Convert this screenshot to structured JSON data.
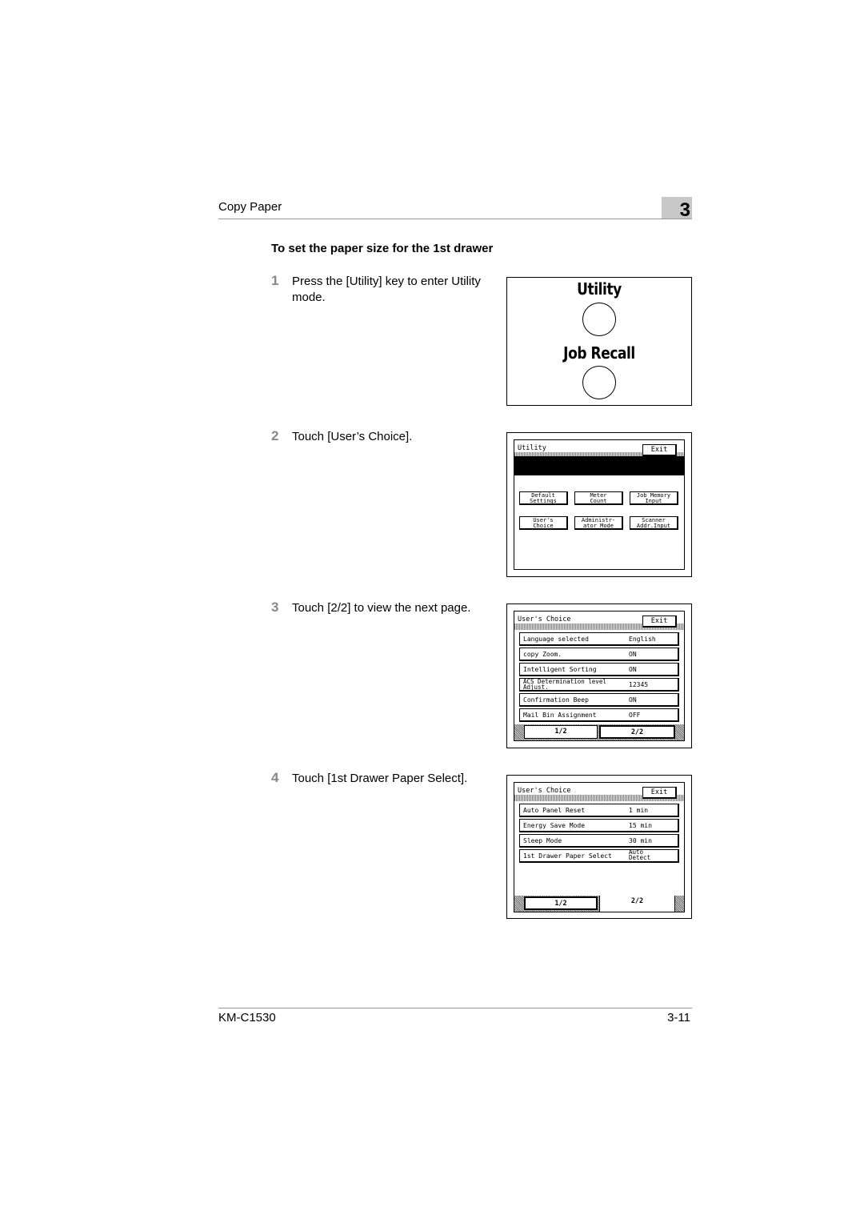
{
  "header": {
    "section": "Copy Paper",
    "chapter": "3"
  },
  "heading": "To set the paper size for the 1st drawer",
  "steps": [
    {
      "number": "1",
      "text": "Press the [Utility] key to enter Utility mode."
    },
    {
      "number": "2",
      "text": "Touch [User’s Choice]."
    },
    {
      "number": "3",
      "text": "Touch [2/2] to view the next page."
    },
    {
      "number": "4",
      "text": "Touch [1st Drawer Paper Select]."
    }
  ],
  "keys": {
    "utility": "Utility",
    "job_recall": "Job Recall"
  },
  "screen_utility": {
    "title": "Utility",
    "exit": "Exit",
    "buttons": [
      [
        "Default",
        "Settings"
      ],
      [
        "Meter",
        "Count"
      ],
      [
        "Job Memory",
        "Input"
      ],
      [
        "User's",
        "Choice"
      ],
      [
        "Administr-",
        "ator Mode"
      ],
      [
        "Scanner",
        "Addr.Input"
      ]
    ]
  },
  "screen_users_choice_1": {
    "title": "User's Choice",
    "exit": "Exit",
    "rows": [
      {
        "label": "Language selected",
        "value": "English"
      },
      {
        "label": "copy Zoom.",
        "value": "ON"
      },
      {
        "label": "Intelligent Sorting",
        "value": "ON"
      },
      {
        "label": "ACS Determination level Adjust.",
        "value": "12345"
      },
      {
        "label": "Confirmation Beep",
        "value": "ON"
      },
      {
        "label": "Mail Bin Assignment",
        "value": "OFF"
      }
    ],
    "tabs": [
      "1/2",
      "2/2"
    ]
  },
  "screen_users_choice_2": {
    "title": "User's Choice",
    "exit": "Exit",
    "rows": [
      {
        "label": "Auto Panel Reset",
        "value": "1 min"
      },
      {
        "label": "Energy Save Mode",
        "value": "15 min"
      },
      {
        "label": "Sleep Mode",
        "value": "30 min"
      },
      {
        "label": "1st Drawer Paper Select",
        "value": "Auto Detect"
      }
    ],
    "tabs": [
      "1/2",
      "2/2"
    ]
  },
  "footer": {
    "model": "KM-C1530",
    "page": "3-11"
  }
}
